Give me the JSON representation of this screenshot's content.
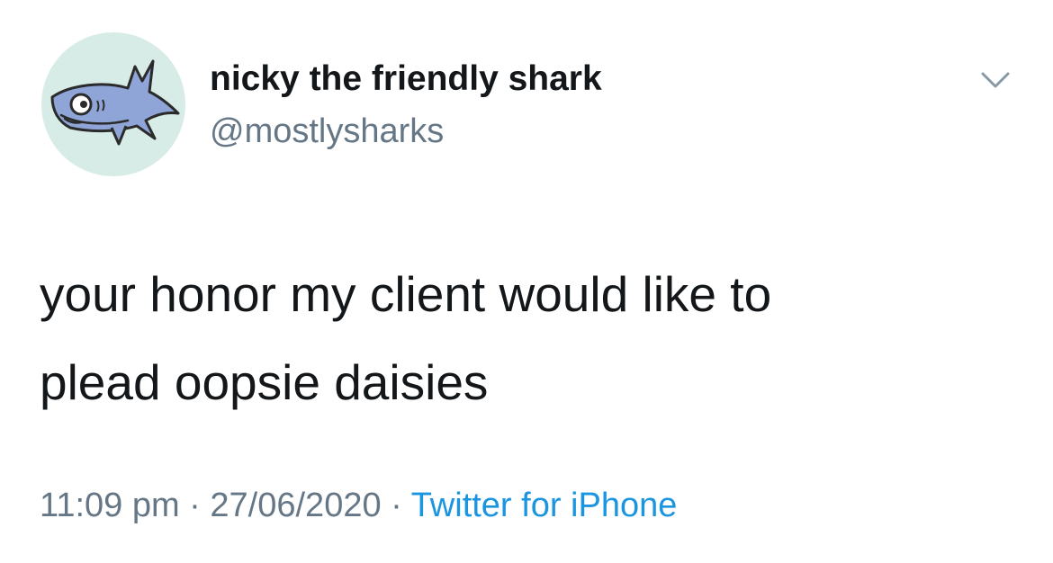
{
  "tweet": {
    "author": {
      "display_name": "nicky the friendly shark",
      "handle": "@mostlysharks",
      "avatar_icon": "shark-cartoon-avatar"
    },
    "menu_icon": "chevron-down-icon",
    "text_lines": [
      "your honor my client would like to",
      "plead oopsie daisies"
    ],
    "meta": {
      "time": "11:09 pm",
      "separator": " · ",
      "date": "27/06/2020",
      "source": "Twitter for iPhone"
    }
  },
  "colors": {
    "text": "#14171a",
    "secondary": "#657786",
    "link": "#1b95e0",
    "avatar_bg": "#d7ece6",
    "shark": "#8fa5d8"
  }
}
